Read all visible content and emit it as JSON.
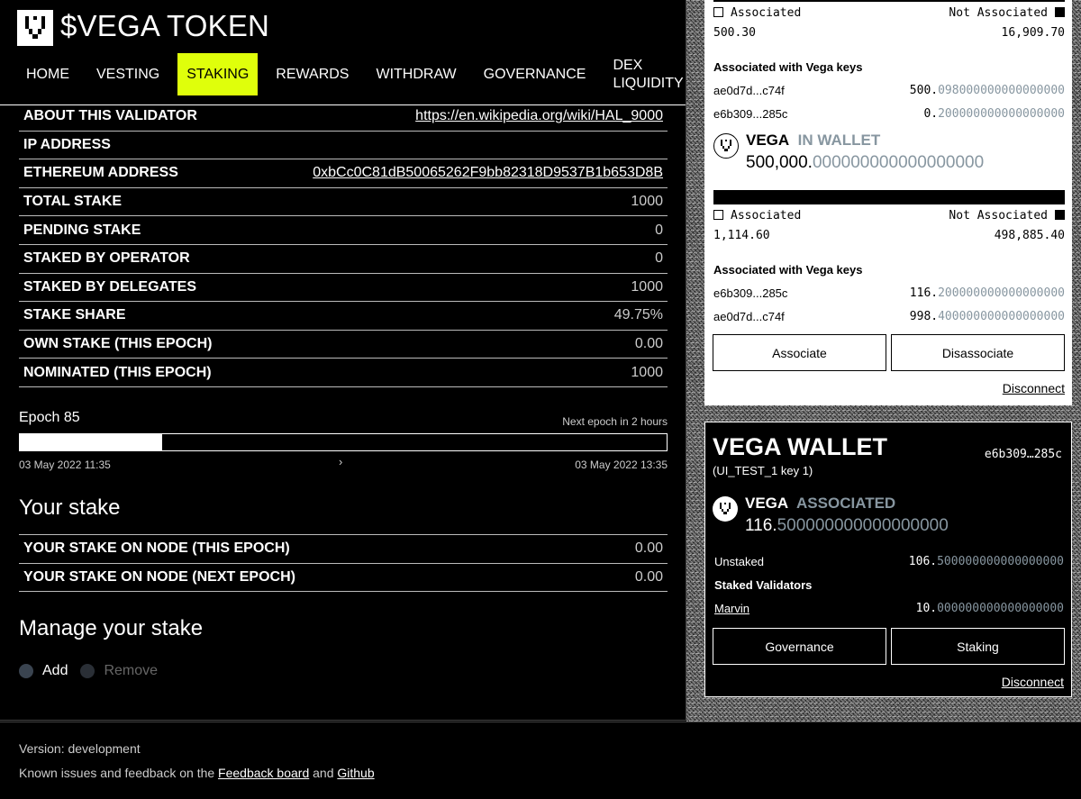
{
  "app": {
    "title": "$VEGA TOKEN"
  },
  "nav": {
    "items": [
      {
        "label": "HOME"
      },
      {
        "label": "VESTING"
      },
      {
        "label": "STAKING"
      },
      {
        "label": "REWARDS"
      },
      {
        "label": "WITHDRAW"
      },
      {
        "label": "GOVERNANCE"
      },
      {
        "label": "DEX LIQUIDITY"
      }
    ],
    "active": "STAKING",
    "active_color": "#dfff0b"
  },
  "validator": {
    "rows": [
      {
        "label": "ABOUT THIS VALIDATOR",
        "value": "https://en.wikipedia.org/wiki/HAL_9000"
      },
      {
        "label": "IP ADDRESS",
        "value": ""
      },
      {
        "label": "ETHEREUM ADDRESS",
        "value": "0xbCc0C81dB50065262F9bb82318D9537B1b653D8B"
      },
      {
        "label": "TOTAL STAKE",
        "value": "1000"
      },
      {
        "label": "PENDING STAKE",
        "value": "0"
      },
      {
        "label": "STAKED BY OPERATOR",
        "value": "0"
      },
      {
        "label": "STAKED BY DELEGATES",
        "value": "1000"
      },
      {
        "label": "STAKE SHARE",
        "value": "49.75%"
      },
      {
        "label": "OWN STAKE (THIS EPOCH)",
        "value": "0.00"
      },
      {
        "label": "NOMINATED (THIS EPOCH)",
        "value": "1000"
      }
    ]
  },
  "epoch": {
    "label": "Epoch 85",
    "next": "Next epoch in 2 hours",
    "start": "03 May 2022 11:35",
    "end": "03 May 2022 13:35",
    "progress": 0.22
  },
  "your_stake": {
    "title": "Your stake",
    "rows": [
      {
        "label": "YOUR STAKE ON NODE (THIS EPOCH)",
        "value": "0.00"
      },
      {
        "label": "YOUR STAKE ON NODE (NEXT EPOCH)",
        "value": "0.00"
      }
    ]
  },
  "manage": {
    "title": "Manage your stake",
    "add": "Add",
    "remove": "Remove"
  },
  "footer": {
    "version": "Version: development",
    "feedback_prefix": "Known issues and feedback on the",
    "feedback_link": "Feedback board",
    "and": "and",
    "github": "Github"
  },
  "eth_wallet": {
    "top": {
      "associated": "Associated",
      "not_associated": "Not Associated",
      "assoc_value": "500.30",
      "not_assoc_value": "16,909.70",
      "keys_label": "Associated with Vega keys",
      "keys": [
        {
          "key": "ae0d7d...c74f",
          "int": "500.",
          "dec": "098000000000000000"
        },
        {
          "key": "e6b309...285c",
          "int": "0.",
          "dec": "200000000000000000"
        }
      ]
    },
    "in_wallet": {
      "name": "VEGA",
      "sub": "IN WALLET",
      "int": "500,000.",
      "dec": "000000000000000000"
    },
    "bottom": {
      "associated": "Associated",
      "not_associated": "Not Associated",
      "assoc_value": "1,114.60",
      "not_assoc_value": "498,885.40",
      "keys_label": "Associated with Vega keys",
      "keys": [
        {
          "key": "e6b309...285c",
          "int": "116.",
          "dec": "200000000000000000"
        },
        {
          "key": "ae0d7d...c74f",
          "int": "998.",
          "dec": "400000000000000000"
        }
      ]
    },
    "associate": "Associate",
    "disassociate": "Disassociate",
    "disconnect": "Disconnect"
  },
  "vega_wallet": {
    "title": "VEGA WALLET",
    "key_short": "e6b309…285c",
    "key_name": "(UI_TEST_1 key 1)",
    "token": {
      "name": "VEGA",
      "sub": "ASSOCIATED",
      "int": "116.",
      "dec": "500000000000000000"
    },
    "unstaked_label": "Unstaked",
    "unstaked_int": "106.",
    "unstaked_dec": "500000000000000000",
    "staked_validators_label": "Staked Validators",
    "validators": [
      {
        "name": "Marvin",
        "int": "10.",
        "dec": "000000000000000000"
      }
    ],
    "governance": "Governance",
    "staking": "Staking",
    "disconnect": "Disconnect"
  }
}
